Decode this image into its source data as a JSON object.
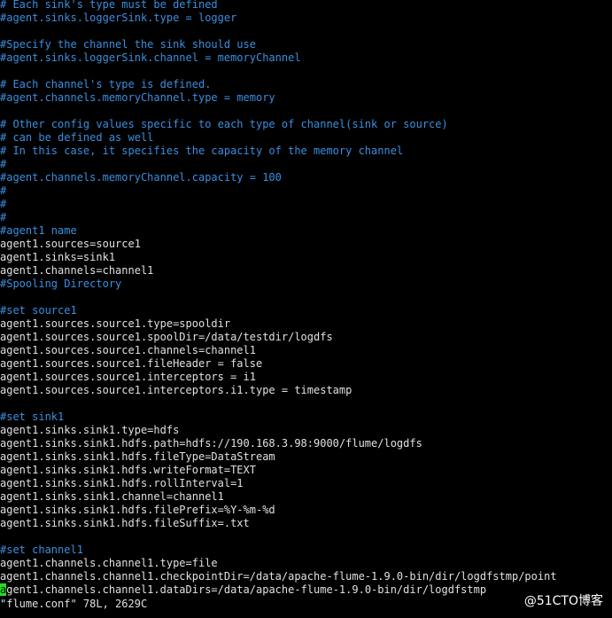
{
  "editor": {
    "lines": [
      "# Each sink's type must be defined",
      "#agent.sinks.loggerSink.type = logger",
      "",
      "#Specify the channel the sink should use",
      "#agent.sinks.loggerSink.channel = memoryChannel",
      "",
      "# Each channel's type is defined.",
      "#agent.channels.memoryChannel.type = memory",
      "",
      "# Other config values specific to each type of channel(sink or source)",
      "# can be defined as well",
      "# In this case, it specifies the capacity of the memory channel",
      "#",
      "#agent.channels.memoryChannel.capacity = 100",
      "#",
      "#",
      "#",
      "#agent1 name",
      "agent1.sources=source1",
      "agent1.sinks=sink1",
      "agent1.channels=channel1",
      "#Spooling Directory",
      "",
      "#set source1",
      "agent1.sources.source1.type=spooldir",
      "agent1.sources.source1.spoolDir=/data/testdir/logdfs",
      "agent1.sources.source1.channels=channel1",
      "agent1.sources.source1.fileHeader = false",
      "agent1.sources.source1.interceptors = i1",
      "agent1.sources.source1.interceptors.i1.type = timestamp",
      "",
      "#set sink1",
      "agent1.sinks.sink1.type=hdfs",
      "agent1.sinks.sink1.hdfs.path=hdfs://190.168.3.98:9000/flume/logdfs",
      "agent1.sinks.sink1.hdfs.fileType=DataStream",
      "agent1.sinks.sink1.hdfs.writeFormat=TEXT",
      "agent1.sinks.sink1.hdfs.rollInterval=1",
      "agent1.sinks.sink1.channel=channel1",
      "agent1.sinks.sink1.hdfs.filePrefix=%Y-%m-%d",
      "agent1.sinks.sink1.hdfs.fileSuffix=.txt",
      "",
      "#set channel1",
      "agent1.channels.channel1.type=file",
      "agent1.channels.channel1.checkpointDir=/data/apache-flume-1.9.0-bin/dir/logdfstmp/point",
      "agent1.channels.channel1.dataDirs=/data/apache-flume-1.9.0-bin/dir/logdfstmp"
    ],
    "cursor_line": 44,
    "cursor_col": 0
  },
  "status": {
    "text": "\"flume.conf\" 78L, 2629C"
  },
  "watermark": {
    "text": "@51CTO博客"
  },
  "colors": {
    "background": "#000000",
    "comment": "#3a8fe0",
    "text": "#e0e0e0",
    "cursor": "#22e022"
  }
}
